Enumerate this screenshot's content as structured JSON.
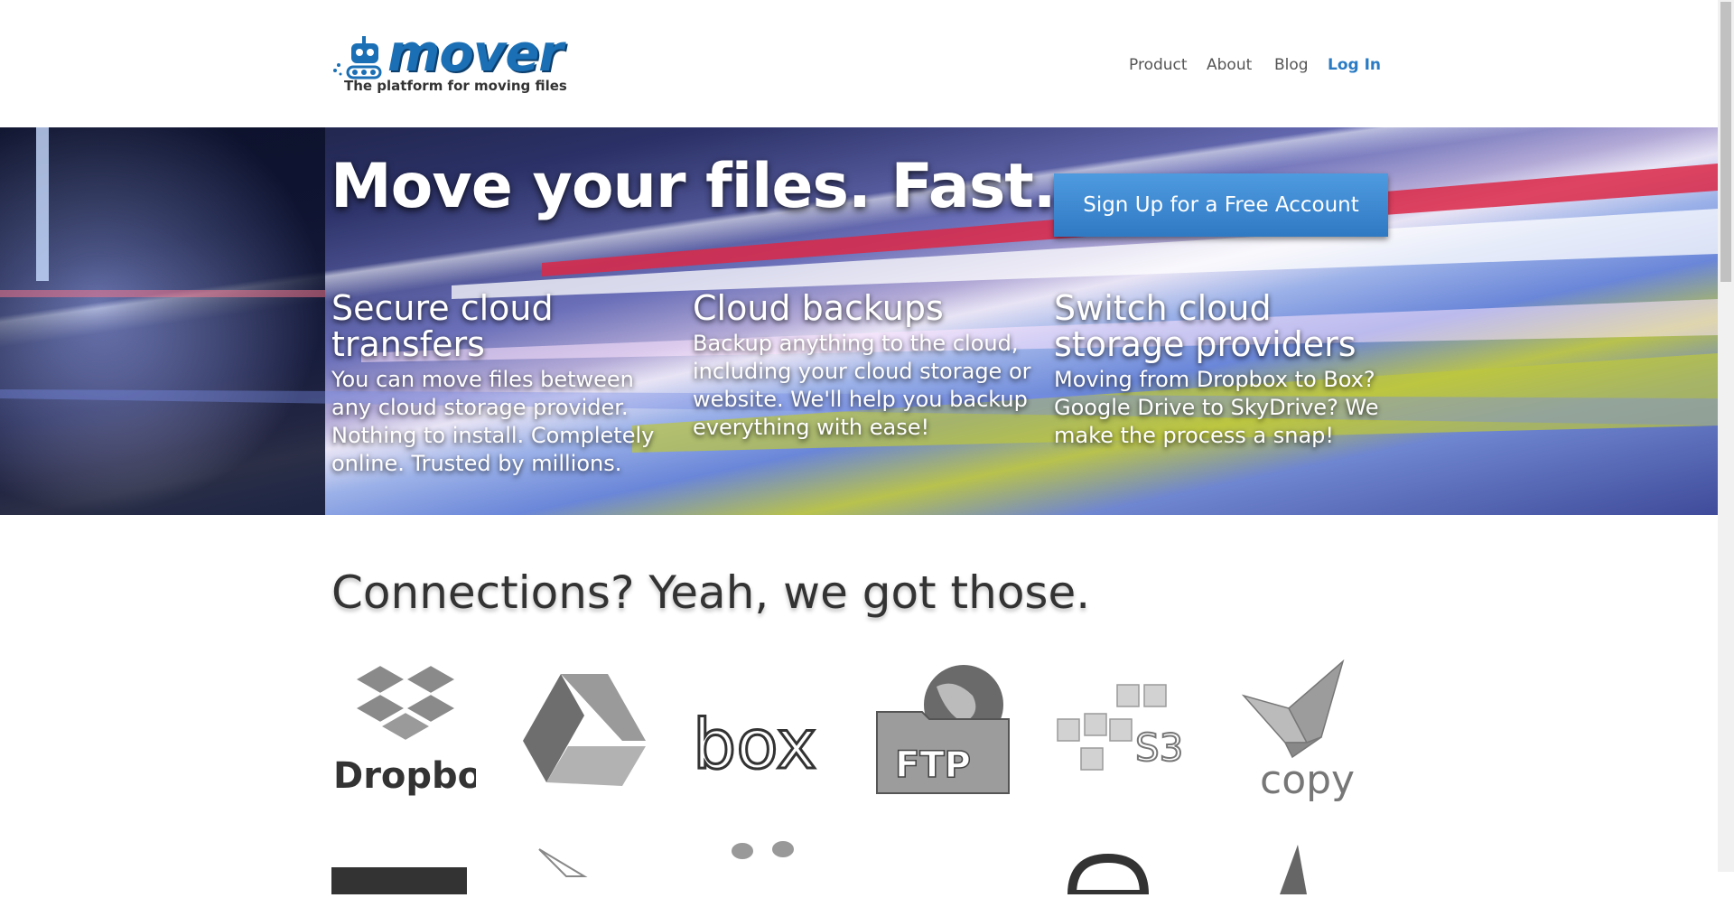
{
  "header": {
    "logo_word": "mover",
    "logo_tagline": "The platform for moving files",
    "nav": [
      {
        "label": "Product"
      },
      {
        "label": "About"
      },
      {
        "label": "Blog"
      },
      {
        "label": "Log In"
      }
    ]
  },
  "hero": {
    "headline": "Move your files. Fast.",
    "signup_label": "Sign Up for a Free Account",
    "features": [
      {
        "title": "Secure cloud transfers",
        "body": "You can move files between any cloud storage provider. Nothing to install. Completely online. Trusted by millions."
      },
      {
        "title": "Cloud backups",
        "body": "Backup anything to the cloud, including your cloud storage or website. We'll help you backup everything with ease!"
      },
      {
        "title": "Switch cloud storage providers",
        "body": "Moving from Dropbox to Box? Google Drive to SkyDrive? We make the process a snap!"
      }
    ]
  },
  "connections": {
    "title": "Connections? Yeah, we got those.",
    "logos": [
      {
        "label": "Dropbox",
        "icon": "dropbox-icon"
      },
      {
        "label": "",
        "icon": "google-drive-icon"
      },
      {
        "label": "box",
        "icon": "box-icon"
      },
      {
        "label": "FTP",
        "icon": "ftp-icon"
      },
      {
        "label": "S3",
        "icon": "s3-icon"
      },
      {
        "label": "copy",
        "icon": "copy-icon"
      }
    ]
  },
  "colors": {
    "accent": "#2a7bc4",
    "button": "#3a87cf",
    "logo_gray": "#7a7a7a"
  }
}
